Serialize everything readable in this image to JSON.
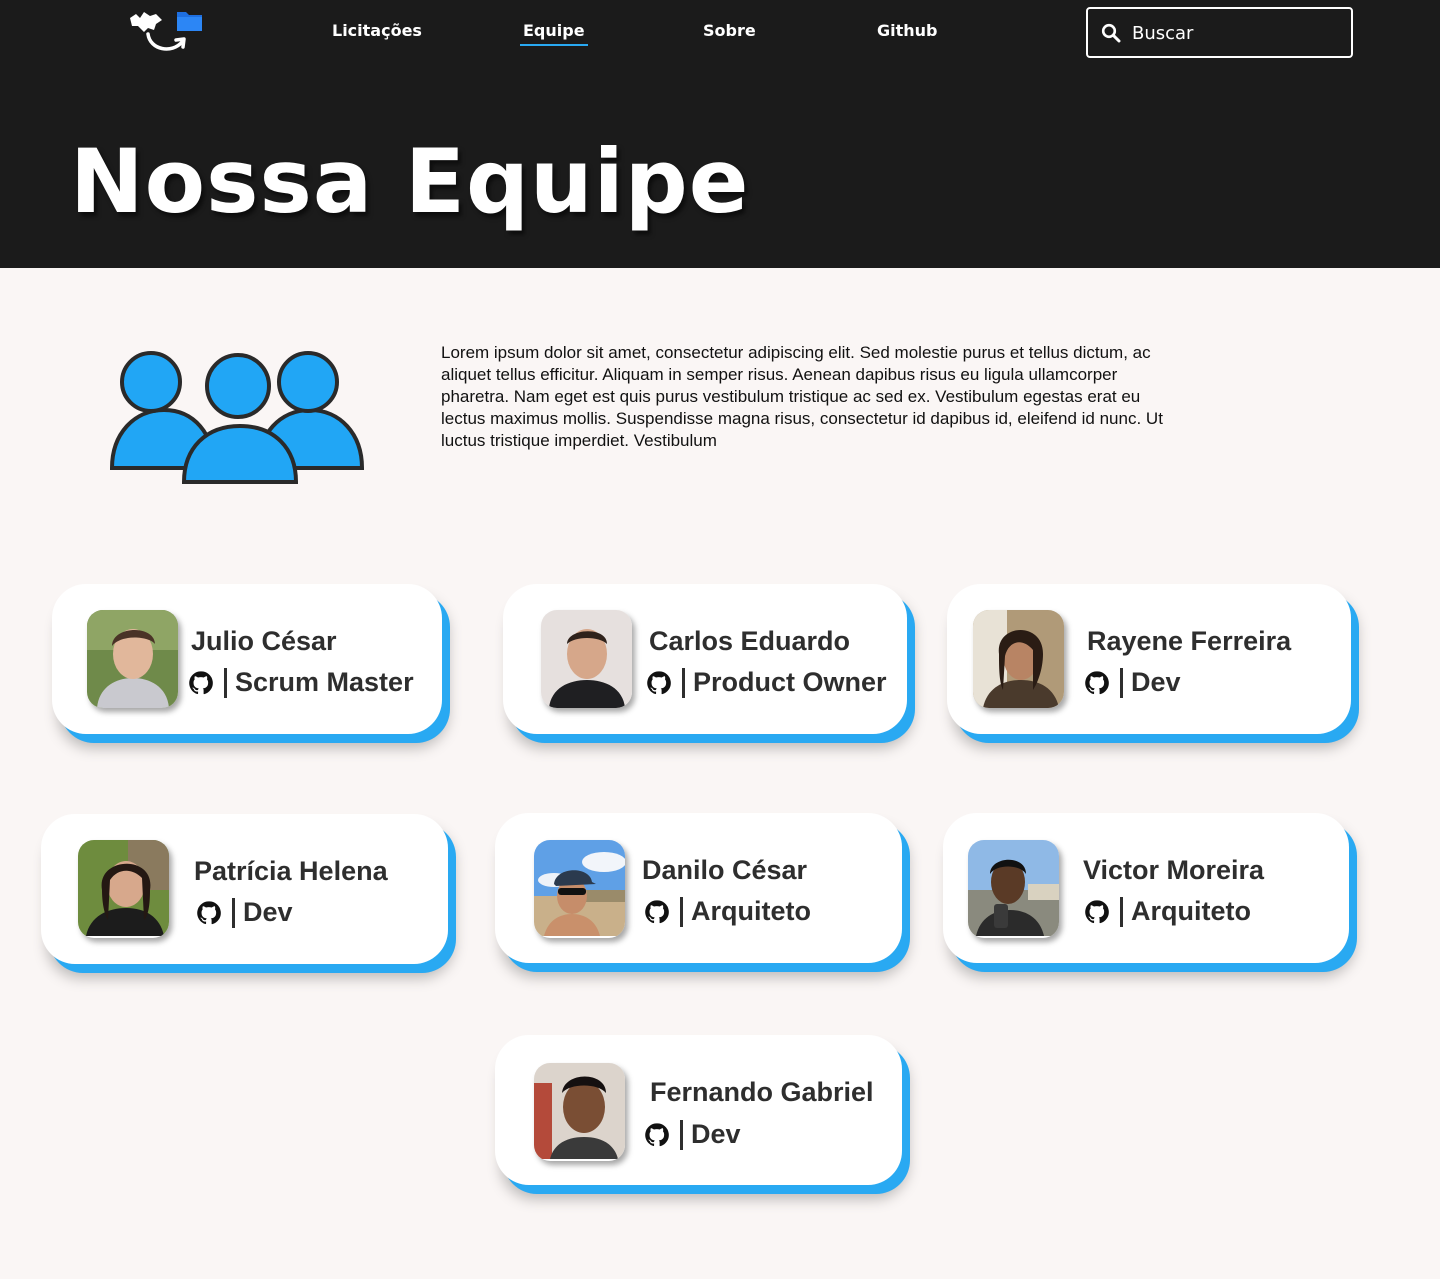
{
  "nav": {
    "items": [
      {
        "label": "Licitações",
        "active": false
      },
      {
        "label": "Equipe",
        "active": true
      },
      {
        "label": "Sobre",
        "active": false
      },
      {
        "label": "Github",
        "active": false
      }
    ],
    "search_placeholder": "Buscar"
  },
  "hero": {
    "title": "Nossa Equipe"
  },
  "intro": {
    "text": "Lorem ipsum dolor sit amet, consectetur adipiscing elit. Sed molestie purus et tellus dictum, ac aliquet tellus efficitur. Aliquam in semper risus. Aenean dapibus risus eu ligula ullamcorper pharetra. Nam eget est quis purus vestibulum tristique ac sed ex. Vestibulum egestas erat eu lectus maximus mollis. Suspendisse magna risus, consectetur id dapibus id, eleifend id nunc. Ut luctus tristique imperdiet. Vestibulum"
  },
  "members": [
    {
      "name": "Julio César",
      "role": "Scrum Master"
    },
    {
      "name": "Carlos Eduardo",
      "role": "Product Owner"
    },
    {
      "name": "Rayene Ferreira",
      "role": "Dev"
    },
    {
      "name": "Patrícia Helena",
      "role": "Dev"
    },
    {
      "name": "Danilo César",
      "role": "Arquiteto"
    },
    {
      "name": "Victor Moreira",
      "role": "Arquiteto"
    },
    {
      "name": "Fernando Gabriel",
      "role": "Dev"
    }
  ],
  "colors": {
    "header_bg": "#1b1b1b",
    "accent": "#29a9f2",
    "page_bg": "#faf6f5",
    "text_dark": "#2e2e2e"
  },
  "icons": {
    "logo": "files-transfer-logo",
    "search": "search-icon",
    "team": "group-users-icon",
    "github": "github-icon"
  }
}
